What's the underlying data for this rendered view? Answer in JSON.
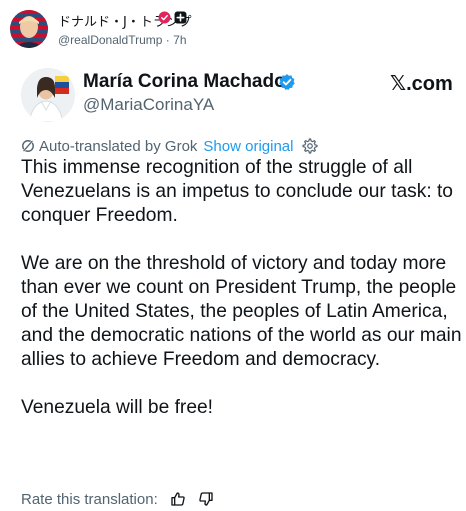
{
  "post": {
    "author_name": "ドナルド・J・トランプ",
    "author_handle": "@realDonaldTrump",
    "separator": "·",
    "time": "7h"
  },
  "card": {
    "name": "María Corina Machado",
    "handle": "@MariaCorinaYA",
    "site": "𝕏.com"
  },
  "translation": {
    "label": "Auto-translated by Grok",
    "show_original": "Show original"
  },
  "body": {
    "paragraphs": [
      "This immense recognition of the struggle of all Venezuelans is an impetus to conclude our task: to conquer Freedom.",
      "We are on the threshold of victory and today more than ever we count on President Trump, the people of the United States, the peoples of Latin America, and the democratic nations of the world as our main allies to achieve Freedom and democracy.",
      "Venezuela will be free!"
    ]
  },
  "rating": {
    "label": "Rate this translation:"
  },
  "colors": {
    "accent": "#1d9bf0",
    "muted": "#536471",
    "text": "#0f1419",
    "verified_pink": "#e0245e"
  },
  "icons": {
    "badge_1": "verified-badge-icon",
    "badge_2": "square-plus-icon",
    "card_verified": "verified-badge-icon",
    "grok": "grok-icon",
    "settings": "gear-icon",
    "thumbs_up": "thumbs-up-icon",
    "thumbs_down": "thumbs-down-icon"
  }
}
